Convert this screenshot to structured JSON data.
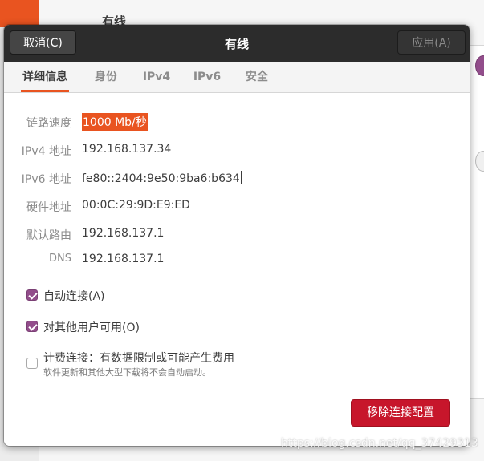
{
  "background": {
    "title": "有线"
  },
  "dialog": {
    "title": "有线",
    "cancel_label": "取消(C)",
    "apply_label": "应用(A)",
    "tabs": [
      {
        "label": "详细信息",
        "active": true
      },
      {
        "label": "身份",
        "active": false
      },
      {
        "label": "IPv4",
        "active": false
      },
      {
        "label": "IPv6",
        "active": false
      },
      {
        "label": "安全",
        "active": false
      }
    ],
    "details": [
      {
        "label": "链路速度",
        "value": "1000 Mb/秒"
      },
      {
        "label": "IPv4 地址",
        "value": "192.168.137.34"
      },
      {
        "label": "IPv6 地址",
        "value": "fe80::2404:9e50:9ba6:b634"
      },
      {
        "label": "硬件地址",
        "value": "00:0C:29:9D:E9:ED"
      },
      {
        "label": "默认路由",
        "value": "192.168.137.1"
      },
      {
        "label": "DNS",
        "value": "192.168.137.1"
      }
    ],
    "options": {
      "auto_connect": {
        "label": "自动连接(A)",
        "checked": true
      },
      "all_users": {
        "label": "对其他用户可用(O)",
        "checked": true
      },
      "metered": {
        "label": "计费连接：有数据限制或可能产生费用",
        "description": "软件更新和其他大型下载将不会自动启动。",
        "checked": false
      }
    },
    "remove_label": "移除连接配置"
  },
  "watermark": "https://blog.csdn.net/qq_37429313",
  "colors": {
    "accent": "#e95420",
    "checkbox": "#924d8b",
    "destructive": "#c7162b",
    "headerbar": "#2c2c2c"
  }
}
